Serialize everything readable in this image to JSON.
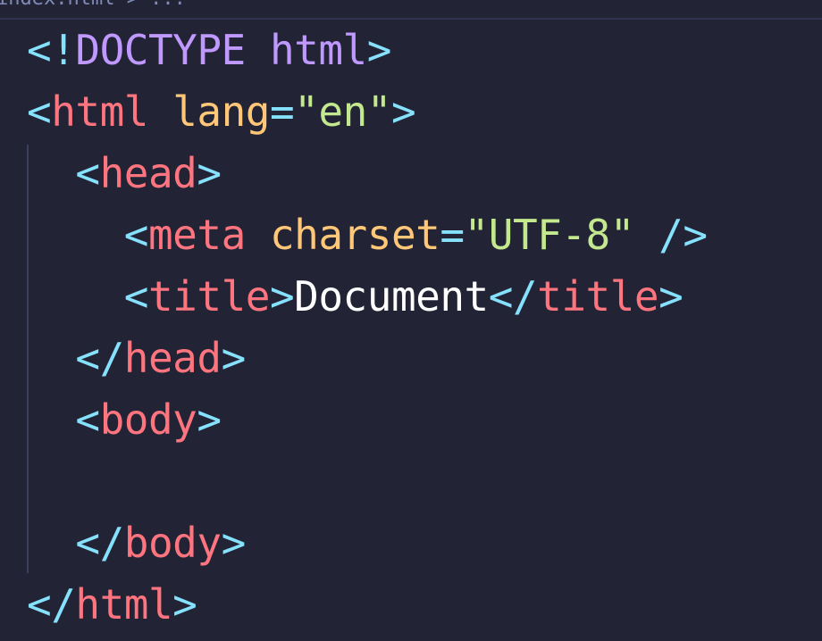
{
  "breadcrumb": {
    "path": "index.html > ..."
  },
  "code": {
    "line1": {
      "open": "<!",
      "doctype": "DOCTYPE",
      "space": " ",
      "html": "html",
      "close": ">"
    },
    "line2": {
      "open": "<",
      "tag": "html",
      "space": " ",
      "attr": "lang",
      "eq": "=",
      "q1": "\"",
      "value": "en",
      "q2": "\"",
      "close": ">"
    },
    "line3": {
      "indent": "  ",
      "open": "<",
      "tag": "head",
      "close": ">"
    },
    "line4": {
      "indent": "    ",
      "open": "<",
      "tag": "meta",
      "space": " ",
      "attr": "charset",
      "eq": "=",
      "q1": "\"",
      "value": "UTF-8",
      "q2": "\"",
      "selfclose": " />"
    },
    "line5": {
      "indent": "    ",
      "open": "<",
      "tag": "title",
      "close": ">",
      "text": "Document",
      "open2": "</",
      "tag2": "title",
      "close2": ">"
    },
    "line6": {
      "indent": "  ",
      "open": "</",
      "tag": "head",
      "close": ">"
    },
    "line7": {
      "indent": "  ",
      "open": "<",
      "tag": "body",
      "close": ">"
    },
    "line9": {
      "indent": "  ",
      "open": "</",
      "tag": "body",
      "close": ">"
    },
    "line10": {
      "open": "</",
      "tag": "html",
      "close": ">"
    }
  },
  "colors": {
    "background": "#222436",
    "bracket": "#86e1fc",
    "doctype": "#c099ff",
    "tag": "#ff757f",
    "attribute": "#ffc777",
    "string": "#c3e88d",
    "text": "#ffffff"
  }
}
